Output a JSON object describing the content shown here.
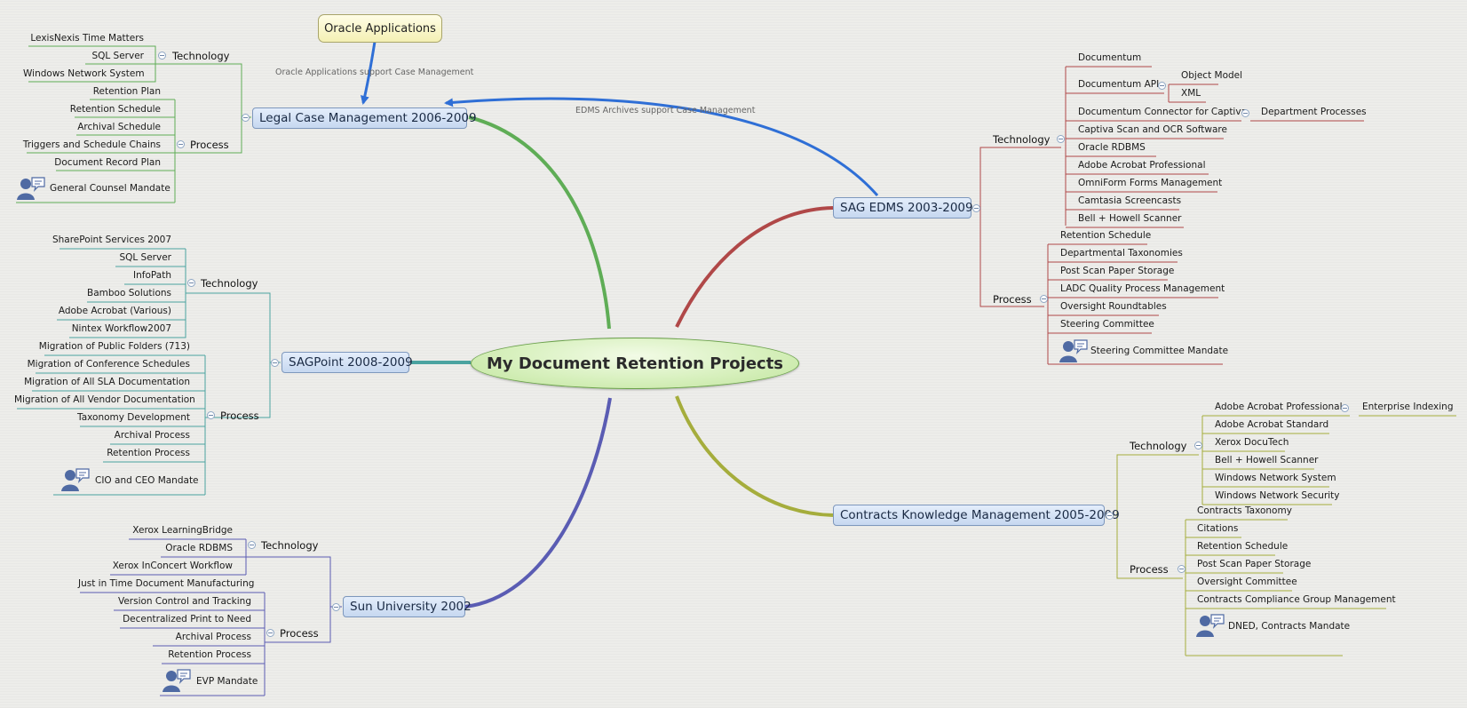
{
  "central_topic": "My Document Retention Projects",
  "floating_topic": "Oracle Applications",
  "relationships": [
    {
      "label": "Oracle Applications  support Case Management"
    },
    {
      "label": "EDMS Archives support Case Management"
    }
  ],
  "colors": {
    "legal": "#5fad56",
    "sagpoint": "#4aa3a0",
    "sun": "#5a5cb3",
    "sag_edms": "#b04848",
    "contracts": "#a5ad3c",
    "relationship": "#2f6fd6"
  },
  "branches": {
    "legal": {
      "title": "Legal Case Management 2006-2009",
      "technology": {
        "label": "Technology",
        "items": [
          "LexisNexis Time Matters",
          "SQL Server",
          "Windows Network System"
        ]
      },
      "process": {
        "label": "Process",
        "items": [
          "Retention Plan",
          "Retention Schedule",
          "Archival Schedule",
          "Triggers and Schedule Chains",
          "Document Record Plan"
        ],
        "mandate": "General Counsel Mandate"
      }
    },
    "sagpoint": {
      "title": "SAGPoint 2008-2009",
      "technology": {
        "label": "Technology",
        "items": [
          "SharePoint Services 2007",
          "SQL Server",
          "InfoPath",
          "Bamboo Solutions",
          "Adobe Acrobat (Various)",
          "Nintex Workflow2007"
        ]
      },
      "process": {
        "label": "Process",
        "items": [
          "Migration of Public Folders (713)",
          "Migration of Conference Schedules",
          "Migration of All SLA Documentation",
          "Migration of All Vendor Documentation",
          "Taxonomy Development",
          "Archival Process",
          "Retention Process"
        ],
        "mandate": "CIO and CEO Mandate"
      }
    },
    "sun": {
      "title": "Sun University 2002",
      "technology": {
        "label": "Technology",
        "items": [
          "Xerox LearningBridge",
          "Oracle RDBMS",
          "Xerox InConcert Workflow"
        ]
      },
      "process": {
        "label": "Process",
        "items": [
          "Just in Time Document Manufacturing",
          "Version Control and Tracking",
          "Decentralized Print to Need",
          "Archival Process",
          "Retention Process"
        ],
        "mandate": "EVP Mandate"
      }
    },
    "sag_edms": {
      "title": "SAG EDMS 2003-2009",
      "technology": {
        "label": "Technology",
        "items": [
          "Documentum",
          "Documentum API",
          "Documentum Connector for Captiva",
          "Captiva Scan and OCR Software",
          "Oracle RDBMS",
          "Adobe Acrobat Professional",
          "OmniForm Forms Management",
          "Camtasia Screencasts",
          "Bell + Howell Scanner"
        ]
      },
      "api_children": [
        "Object Model",
        "XML"
      ],
      "connector_child": "Department Processes",
      "process": {
        "label": "Process",
        "items": [
          "Retention Schedule",
          "Departmental Taxonomies",
          "Post Scan Paper Storage",
          "LADC Quality Process Management",
          "Oversight Roundtables",
          "Steering Committee"
        ],
        "mandate": "Steering Committee Mandate"
      }
    },
    "contracts": {
      "title": "Contracts Knowledge Management 2005-2009",
      "technology": {
        "label": "Technology",
        "items": [
          "Adobe Acrobat Professional",
          "Adobe Acrobat Standard",
          "Xerox DocuTech",
          "Bell + Howell Scanner",
          "Windows Network System",
          "Windows Network Security"
        ]
      },
      "acrobat_child": "Enterprise Indexing",
      "process": {
        "label": "Process",
        "items": [
          "Contracts Taxonomy",
          "Citations",
          "Retention Schedule",
          "Post Scan Paper Storage",
          "Oversight Committee",
          "Contracts Compliance Group Management"
        ],
        "mandate": "DNED, Contracts Mandate"
      }
    }
  }
}
